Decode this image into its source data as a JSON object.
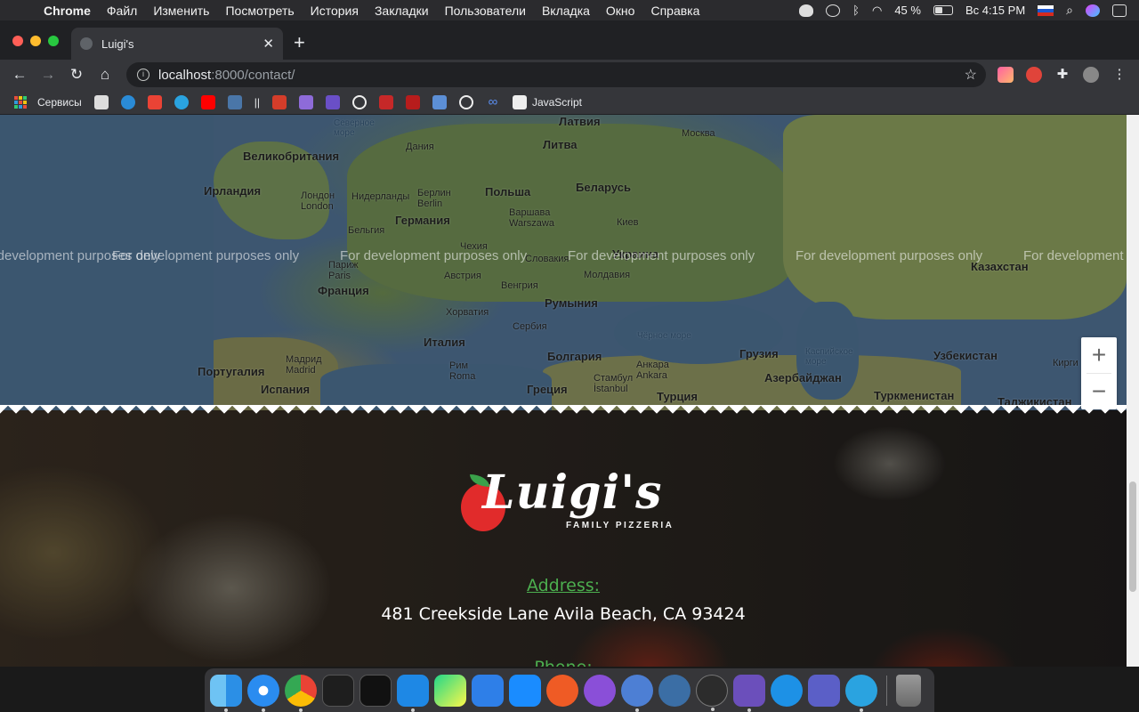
{
  "menubar": {
    "app": "Chrome",
    "items": [
      "Файл",
      "Изменить",
      "Посмотреть",
      "История",
      "Закладки",
      "Пользователи",
      "Вкладка",
      "Окно",
      "Справка"
    ],
    "battery": "45 %",
    "clock": "Вс 4:15 PM"
  },
  "browser": {
    "tab_title": "Luigi's",
    "url_host": "localhost",
    "url_path": ":8000/contact/",
    "bookmarks": [
      "Сервисы",
      "||",
      "JavaScript"
    ]
  },
  "map": {
    "watermark": "For development purposes only",
    "labels": {
      "latvia": "Латвия",
      "north_sea": "Северное море",
      "denmark": "Дания",
      "lithuania": "Литва",
      "moscow": "Москва",
      "uk": "Великобритания",
      "belarus": "Беларусь",
      "ireland": "Ирландия",
      "london": "Лондон London",
      "netherlands": "Нидерланды",
      "berlin": "Берлин Berlin",
      "poland": "Польша",
      "warsaw": "Варшава Warszawa",
      "germany": "Германия",
      "kyiv": "Киев",
      "belgium": "Бельгия",
      "czech": "Чехия",
      "slovakia": "Словакия",
      "ukraine": "Украина",
      "paris": "Париж Paris",
      "austria": "Австрия",
      "moldova": "Молдавия",
      "kazakhstan": "Казахстан",
      "france": "Франция",
      "hungary": "Венгрия",
      "romania": "Румыния",
      "croatia": "Хорватия",
      "serbia": "Сербия",
      "black_sea": "Чёрное море",
      "italy": "Италия",
      "bulgaria": "Болгария",
      "georgia": "Грузия",
      "caspian": "Каспийское море",
      "uzbekistan": "Узбекистан",
      "kyrgyz": "Кирги",
      "portugal": "Португалия",
      "madrid": "Мадрид Madrid",
      "rome": "Рим Roma",
      "ankara": "Анкара Ankara",
      "istanbul": "Стамбул İstanbul",
      "azerbaijan": "Азербайджан",
      "spain": "Испания",
      "greece": "Греция",
      "turkey": "Турция",
      "turkmenistan": "Туркменистан",
      "tajikistan": "Таджикистан"
    },
    "zoom_in": "+",
    "zoom_out": "−"
  },
  "footer": {
    "logo_word": "Luigi's",
    "logo_sub": "FAMILY PIZZERIA",
    "address_label": "Address:",
    "address_value": "481 Creekside Lane Avila Beach, CA 93424",
    "phone_label": "Phone:"
  },
  "colors": {
    "accent_green": "#4cae4f",
    "map_water": "#3d5670",
    "tomato_red": "#e12b2b"
  },
  "icons": {
    "menubar_left": "apple-icon",
    "tray": [
      "evernote-icon",
      "postgres-icon",
      "bluetooth-icon",
      "wifi-icon",
      "battery-icon",
      "flag-ru-icon",
      "spotlight-icon",
      "siri-icon",
      "control-center-icon"
    ],
    "dock": [
      "finder-icon",
      "safari-icon",
      "chrome-icon",
      "activity-monitor-icon",
      "terminal-icon",
      "vscode-icon",
      "pycharm-icon",
      "xcode-icon",
      "app-store-icon",
      "postman-icon",
      "github-desktop-icon",
      "tableplus-icon",
      "pgadmin-icon",
      "proxyman-icon",
      "dbeaver-icon",
      "docker-icon",
      "teams-icon",
      "telegram-icon",
      "trash-icon"
    ]
  }
}
